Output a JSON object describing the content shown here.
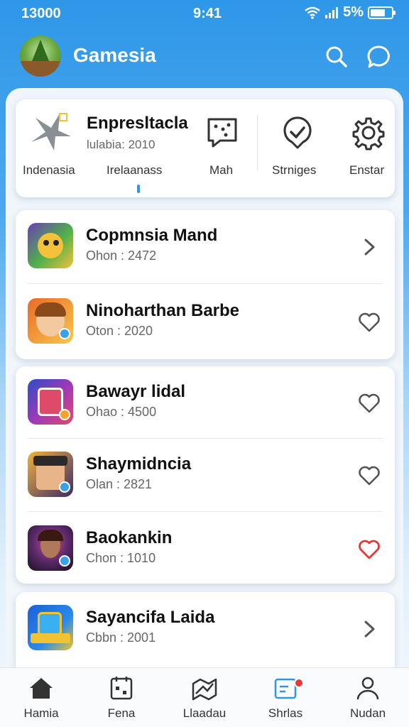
{
  "status_bar": {
    "left_text": "13000",
    "center_text": "9:41",
    "battery_text": "5%"
  },
  "header": {
    "title": "Gamesia",
    "search_icon": "search-icon",
    "chat_icon": "chat-bubble-icon"
  },
  "quick_panel": {
    "featured_title": "Enpresltacla",
    "featured_subtitle": "lulabia: 2010",
    "items": [
      {
        "label": "Indenasia",
        "icon": "star-burst-icon"
      },
      {
        "label": "Irelaanass",
        "icon": ""
      },
      {
        "label": "Mah",
        "icon": "chat-dice-icon"
      },
      {
        "label": "Strniges",
        "icon": "check-pin-icon"
      },
      {
        "label": "Enstar",
        "icon": "gear-icon"
      }
    ]
  },
  "games": [
    {
      "title": "Copmnsia Mand",
      "subtitle": "Ohon : 2472",
      "action": "chevron-right-icon",
      "liked": false,
      "thumb_colors": [
        "#6a3fb3",
        "#f4c13a"
      ]
    },
    {
      "title": "Ninoharthan Barbe",
      "subtitle": "Oton : 2020",
      "action": "heart-outline-icon",
      "liked": false,
      "thumb_colors": [
        "#e96a2a",
        "#f7c84a"
      ]
    },
    {
      "title": "Bawayr lidal",
      "subtitle": "Ohao : 4500",
      "action": "heart-outline-icon",
      "liked": false,
      "thumb_colors": [
        "#2b4ec8",
        "#e04a6a"
      ]
    },
    {
      "title": "Shaymidncia",
      "subtitle": "Olan : 2821",
      "action": "heart-outline-icon",
      "liked": false,
      "thumb_colors": [
        "#f2b23a",
        "#3a2a6a"
      ]
    },
    {
      "title": "Baokankin",
      "subtitle": "Chon : 1010",
      "action": "heart-outline-icon",
      "liked": true,
      "thumb_colors": [
        "#2a1a3a",
        "#c94a8a"
      ]
    },
    {
      "title": "Sayancifa Laida",
      "subtitle": "Cbbn : 2001",
      "action": "chevron-right-icon",
      "liked": false,
      "thumb_colors": [
        "#1e5fd8",
        "#f1c231"
      ]
    }
  ],
  "bottom_nav": [
    {
      "label": "Hamia",
      "icon": "home-icon"
    },
    {
      "label": "Fena",
      "icon": "calendar-icon"
    },
    {
      "label": "Llaadau",
      "icon": "map-icon"
    },
    {
      "label": "Shrlas",
      "icon": "message-square-icon",
      "badge": true
    },
    {
      "label": "Nudan",
      "icon": "user-icon"
    }
  ],
  "colors": {
    "accent": "#2e97e8",
    "liked_heart": "#e53935",
    "icon_gray": "#555555"
  }
}
